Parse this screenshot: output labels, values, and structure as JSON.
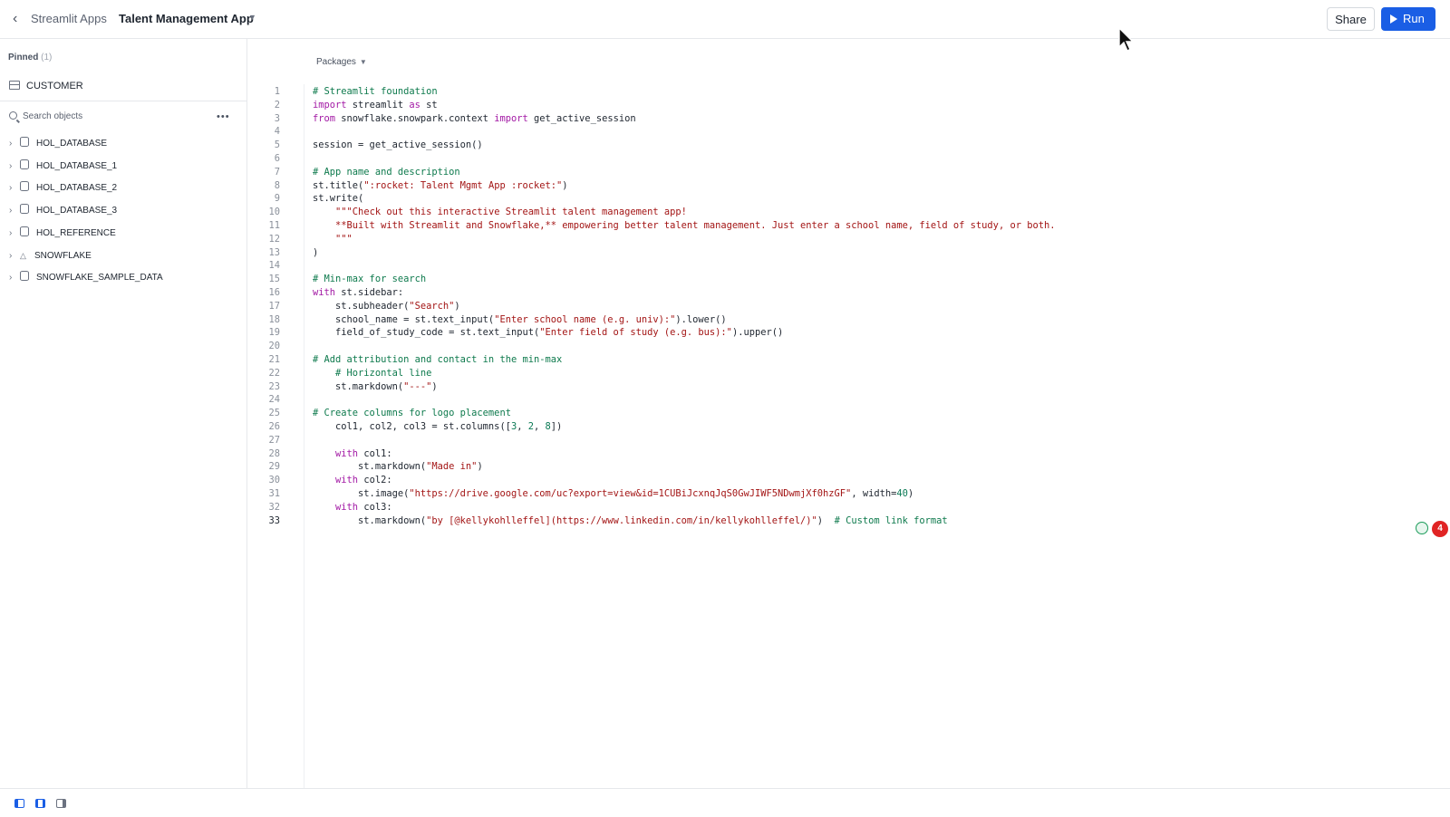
{
  "header": {
    "breadcrumb": "Streamlit Apps",
    "app_title": "Talent Management App",
    "share_label": "Share",
    "run_label": "Run"
  },
  "sidebar": {
    "pinned_label": "Pinned",
    "pinned_count": "(1)",
    "pinned_items": [
      "CUSTOMER"
    ],
    "search_placeholder": "Search objects",
    "databases": [
      {
        "name": "HOL_DATABASE",
        "icon": "database-icon"
      },
      {
        "name": "HOL_DATABASE_1",
        "icon": "database-icon"
      },
      {
        "name": "HOL_DATABASE_2",
        "icon": "database-icon"
      },
      {
        "name": "HOL_DATABASE_3",
        "icon": "database-icon"
      },
      {
        "name": "HOL_REFERENCE",
        "icon": "database-icon"
      },
      {
        "name": "SNOWFLAKE",
        "icon": "snowflake-share-icon"
      },
      {
        "name": "SNOWFLAKE_SAMPLE_DATA",
        "icon": "database-icon"
      }
    ]
  },
  "editor": {
    "packages_label": "Packages",
    "active_line": 33,
    "lines": [
      "# Streamlit foundation",
      "import streamlit as st",
      "from snowflake.snowpark.context import get_active_session",
      "",
      "session = get_active_session()",
      "",
      "# App name and description",
      "st.title(\":rocket: Talent Mgmt App :rocket:\")",
      "st.write(",
      "    \"\"\"Check out this interactive Streamlit talent management app!",
      "    **Built with Streamlit and Snowflake,** empowering better talent management. Just enter a school name, field of study, or both.",
      "    \"\"\"",
      ")",
      "",
      "# Min-max for search",
      "with st.sidebar:",
      "    st.subheader(\"Search\")",
      "    school_name = st.text_input(\"Enter school name (e.g. univ):\").lower()",
      "    field_of_study_code = st.text_input(\"Enter field of study (e.g. bus):\").upper()",
      "",
      "# Add attribution and contact in the min-max",
      "    # Horizontal line",
      "    st.markdown(\"---\")",
      "",
      "# Create columns for logo placement",
      "    col1, col2, col3 = st.columns([3, 2, 8])",
      "",
      "    with col1:",
      "        st.markdown(\"Made in\")",
      "    with col2:",
      "        st.image(\"https://drive.google.com/uc?export=view&id=1CUBiJcxnqJqS0GwJIWF5NDwmjXf0hzGF\", width=40)",
      "    with col3:",
      "        st.markdown(\"by [@kellykohlleffel](https://www.linkedin.com/in/kellykohlleffel/)\")  # Custom link format"
    ]
  },
  "status": {
    "issue_count": "4"
  },
  "colors": {
    "accent": "#1a5ee5",
    "comment": "#0e7a4d",
    "keyword": "#a31aa5",
    "string": "#a31515",
    "error_badge": "#e02424"
  }
}
